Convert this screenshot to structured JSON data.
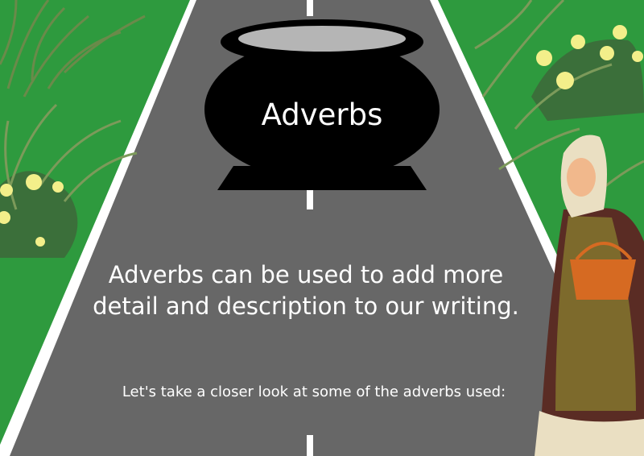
{
  "title": "Adverbs",
  "paragraph": "Adverbs can be used to add more detail and description to our writing.",
  "subtext": "Let's take a closer look at some of the adverbs used:",
  "colors": {
    "grass": "#2e9a3e",
    "road": "#676767",
    "road_line": "#ffffff",
    "cauldron": "#000000",
    "cauldron_rim": "#b5b5b5",
    "flower": "#f3ef8a"
  },
  "icons": [
    "cauldron-icon",
    "villager-woman-illustration",
    "flower-bush-icon",
    "basket-icon"
  ]
}
